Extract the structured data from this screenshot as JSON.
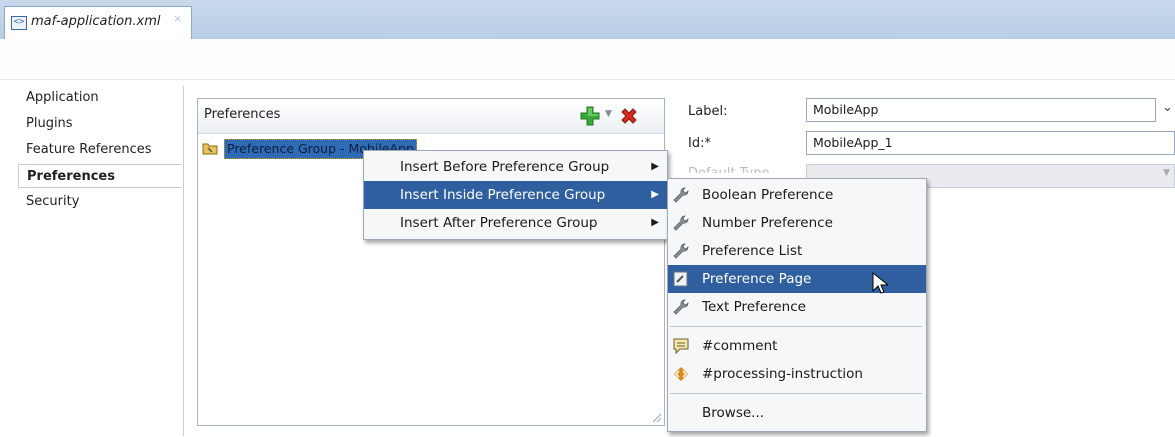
{
  "editor_tab": {
    "label": "maf-application.xml",
    "close": "×",
    "icon": "xml-file-icon"
  },
  "nav": {
    "items": [
      {
        "label": "Application",
        "selected": false
      },
      {
        "label": "Plugins",
        "selected": false
      },
      {
        "label": "Feature References",
        "selected": false
      },
      {
        "label": "Preferences",
        "selected": true
      },
      {
        "label": "Security",
        "selected": false
      }
    ]
  },
  "preferences_panel": {
    "title": "Preferences",
    "add_icon": "green-plus-icon",
    "delete_icon": "red-x-icon",
    "tree_item": "Preference Group - MobileApp"
  },
  "form": {
    "label_label": "Label:",
    "label_value": "MobileApp",
    "id_label": "Id:*",
    "id_value": "MobileApp_1",
    "type_label_partial": "Default Type"
  },
  "context_menu": {
    "items": [
      {
        "label": "Insert Before Preference Group",
        "mnemonic_index": 7
      },
      {
        "label": "Insert Inside Preference Group",
        "mnemonic_index": 0,
        "highlighted": true
      },
      {
        "label": "Insert After Preference Group",
        "mnemonic_index": 7
      }
    ]
  },
  "submenu": {
    "items": [
      {
        "label": "Boolean Preference",
        "icon": "wrench-icon"
      },
      {
        "label": "Number Preference",
        "icon": "wrench-icon"
      },
      {
        "label": "Preference List",
        "icon": "wrench-icon"
      },
      {
        "label": "Preference Page",
        "icon": "preference-page-icon",
        "highlighted": true
      },
      {
        "label": "Text Preference",
        "icon": "wrench-icon"
      },
      {
        "label": "#comment",
        "icon": "comment-icon"
      },
      {
        "label": "#processing-instruction",
        "icon": "processing-instruction-icon"
      },
      {
        "label": "Browse..."
      }
    ]
  },
  "colors": {
    "highlight": "#2f5f9e",
    "tab_bar": "#c9d9ec",
    "add_green": "#3aa83a",
    "delete_red": "#d22b1f"
  }
}
